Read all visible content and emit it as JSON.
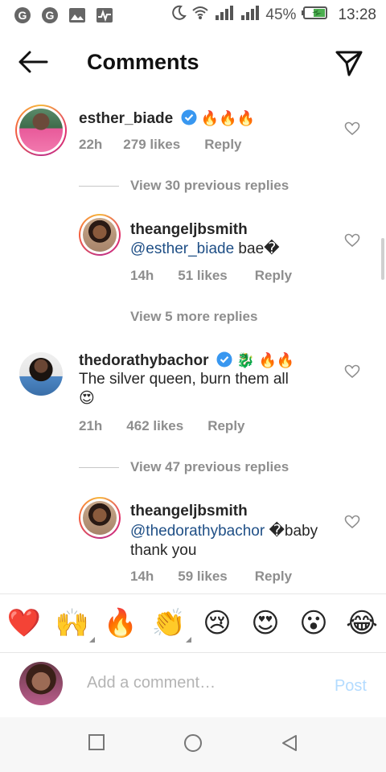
{
  "status_bar": {
    "battery": "45%",
    "time": "13:28"
  },
  "header": {
    "title": "Comments"
  },
  "comments": [
    {
      "username": "esther_biade",
      "verified": true,
      "emojis": "🔥🔥🔥",
      "text": "",
      "time": "22h",
      "likes": "279 likes",
      "reply": "Reply",
      "view_replies": "View 30 previous replies"
    },
    {
      "username": "theangeljbsmith",
      "mention": "@esther_biade",
      "text": " bae�",
      "time": "14h",
      "likes": "51 likes",
      "reply": "Reply",
      "view_replies": "View 5 more replies"
    },
    {
      "username": "thedorathybachor",
      "verified": true,
      "emojis": " 🐉 🔥🔥",
      "text": "The silver queen, burn them all",
      "text2": "😍",
      "time": "21h",
      "likes": "462 likes",
      "reply": "Reply",
      "view_replies": "View 47 previous replies"
    },
    {
      "username": "theangeljbsmith",
      "mention": "@thedorathybachor",
      "text": " �baby",
      "text2": "thank you",
      "time": "14h",
      "likes": "59 likes",
      "reply": "Reply"
    }
  ],
  "emoji_bar": [
    "❤️",
    "🙌",
    "🔥",
    "👏",
    "😢",
    "😍",
    "😮",
    "😂"
  ],
  "comment_input": {
    "placeholder": "Add a comment…",
    "post_label": "Post"
  },
  "colors": {
    "mention": "#1f4f86",
    "muted": "#8e8e8e",
    "post_disabled": "#b3dbff",
    "verified_blue": "#3897f0"
  }
}
